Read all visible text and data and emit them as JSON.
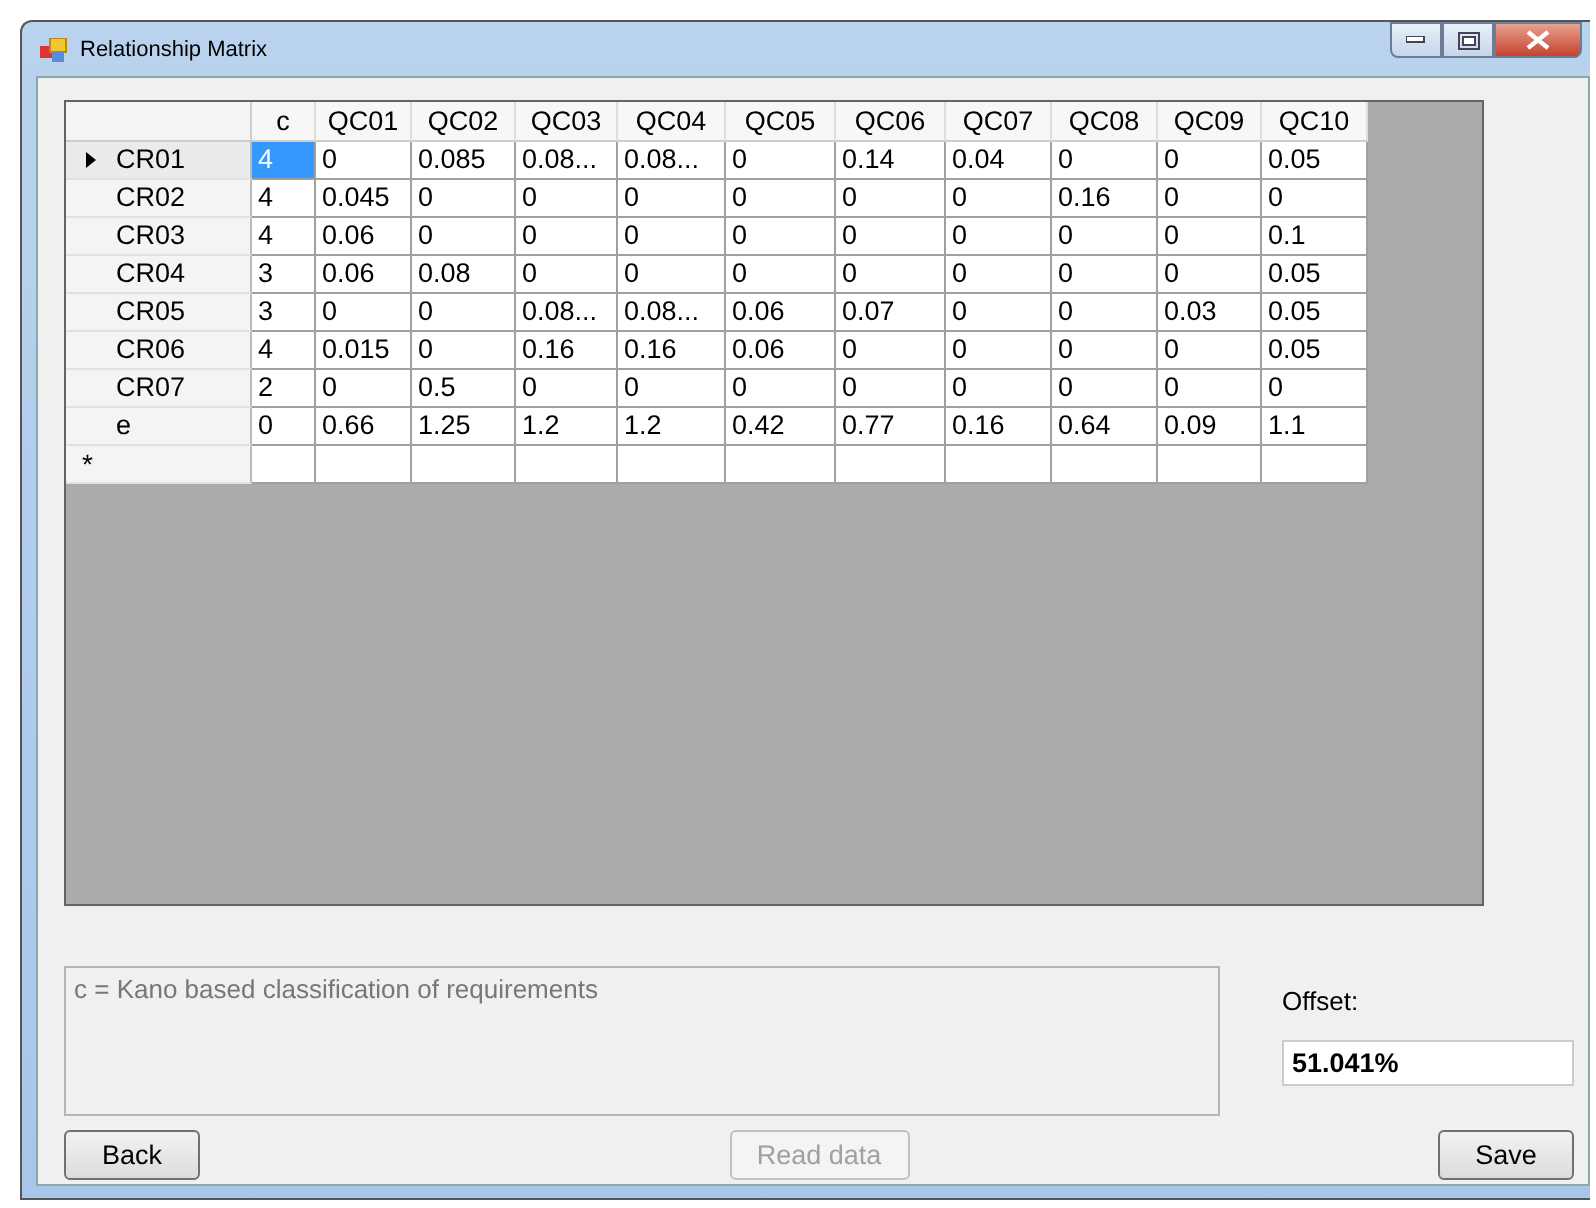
{
  "window": {
    "title": "Relationship Matrix"
  },
  "grid": {
    "columns": [
      "c",
      "QC01",
      "QC02",
      "QC03",
      "QC04",
      "QC05",
      "QC06",
      "QC07",
      "QC08",
      "QC09",
      "QC10"
    ],
    "rows": [
      {
        "header": "CR01",
        "current": true,
        "cells": [
          {
            "text": "4",
            "selected": true
          },
          {
            "text": "0",
            "selected": false
          },
          {
            "text": "0.085",
            "selected": false
          },
          {
            "text": "0.08...",
            "selected": false
          },
          {
            "text": "0.08...",
            "selected": false
          },
          {
            "text": "0",
            "selected": false
          },
          {
            "text": "0.14",
            "selected": false
          },
          {
            "text": "0.04",
            "selected": false
          },
          {
            "text": "0",
            "selected": false
          },
          {
            "text": "0",
            "selected": false
          },
          {
            "text": "0.05",
            "selected": false
          }
        ]
      },
      {
        "header": "CR02",
        "current": false,
        "cells": [
          {
            "text": "4",
            "selected": false
          },
          {
            "text": "0.045",
            "selected": false
          },
          {
            "text": "0",
            "selected": false
          },
          {
            "text": "0",
            "selected": false
          },
          {
            "text": "0",
            "selected": false
          },
          {
            "text": "0",
            "selected": false
          },
          {
            "text": "0",
            "selected": false
          },
          {
            "text": "0",
            "selected": false
          },
          {
            "text": "0.16",
            "selected": false
          },
          {
            "text": "0",
            "selected": false
          },
          {
            "text": "0",
            "selected": false
          }
        ]
      },
      {
        "header": "CR03",
        "current": false,
        "cells": [
          {
            "text": "4",
            "selected": false
          },
          {
            "text": "0.06",
            "selected": false
          },
          {
            "text": "0",
            "selected": false
          },
          {
            "text": "0",
            "selected": false
          },
          {
            "text": "0",
            "selected": false
          },
          {
            "text": "0",
            "selected": false
          },
          {
            "text": "0",
            "selected": false
          },
          {
            "text": "0",
            "selected": false
          },
          {
            "text": "0",
            "selected": false
          },
          {
            "text": "0",
            "selected": false
          },
          {
            "text": "0.1",
            "selected": false
          }
        ]
      },
      {
        "header": "CR04",
        "current": false,
        "cells": [
          {
            "text": "3",
            "selected": false
          },
          {
            "text": "0.06",
            "selected": false
          },
          {
            "text": "0.08",
            "selected": false
          },
          {
            "text": "0",
            "selected": false
          },
          {
            "text": "0",
            "selected": false
          },
          {
            "text": "0",
            "selected": false
          },
          {
            "text": "0",
            "selected": false
          },
          {
            "text": "0",
            "selected": false
          },
          {
            "text": "0",
            "selected": false
          },
          {
            "text": "0",
            "selected": false
          },
          {
            "text": "0.05",
            "selected": false
          }
        ]
      },
      {
        "header": "CR05",
        "current": false,
        "cells": [
          {
            "text": "3",
            "selected": false
          },
          {
            "text": "0",
            "selected": false
          },
          {
            "text": "0",
            "selected": false
          },
          {
            "text": "0.08...",
            "selected": false
          },
          {
            "text": "0.08...",
            "selected": false
          },
          {
            "text": "0.06",
            "selected": false
          },
          {
            "text": "0.07",
            "selected": false
          },
          {
            "text": "0",
            "selected": false
          },
          {
            "text": "0",
            "selected": false
          },
          {
            "text": "0.03",
            "selected": false
          },
          {
            "text": "0.05",
            "selected": false
          }
        ]
      },
      {
        "header": "CR06",
        "current": false,
        "cells": [
          {
            "text": "4",
            "selected": false
          },
          {
            "text": "0.015",
            "selected": false
          },
          {
            "text": "0",
            "selected": false
          },
          {
            "text": "0.16",
            "selected": false
          },
          {
            "text": "0.16",
            "selected": false
          },
          {
            "text": "0.06",
            "selected": false
          },
          {
            "text": "0",
            "selected": false
          },
          {
            "text": "0",
            "selected": false
          },
          {
            "text": "0",
            "selected": false
          },
          {
            "text": "0",
            "selected": false
          },
          {
            "text": "0.05",
            "selected": false
          }
        ]
      },
      {
        "header": "CR07",
        "current": false,
        "cells": [
          {
            "text": "2",
            "selected": false
          },
          {
            "text": "0",
            "selected": false
          },
          {
            "text": "0.5",
            "selected": false
          },
          {
            "text": "0",
            "selected": false
          },
          {
            "text": "0",
            "selected": false
          },
          {
            "text": "0",
            "selected": false
          },
          {
            "text": "0",
            "selected": false
          },
          {
            "text": "0",
            "selected": false
          },
          {
            "text": "0",
            "selected": false
          },
          {
            "text": "0",
            "selected": false
          },
          {
            "text": "0",
            "selected": false
          }
        ]
      },
      {
        "header": "e",
        "current": false,
        "cells": [
          {
            "text": "0",
            "selected": false
          },
          {
            "text": "0.66",
            "selected": false
          },
          {
            "text": "1.25",
            "selected": false
          },
          {
            "text": "1.2",
            "selected": false
          },
          {
            "text": "1.2",
            "selected": false
          },
          {
            "text": "0.42",
            "selected": false
          },
          {
            "text": "0.77",
            "selected": false
          },
          {
            "text": "0.16",
            "selected": false
          },
          {
            "text": "0.64",
            "selected": false
          },
          {
            "text": "0.09",
            "selected": false
          },
          {
            "text": "1.1",
            "selected": false
          }
        ]
      }
    ],
    "new_row": {
      "marker": "*"
    }
  },
  "note": {
    "value": "c = Kano based classification of requirements"
  },
  "offset": {
    "label": "Offset:",
    "value": "51.041%"
  },
  "buttons": [
    {
      "label": "Back",
      "disabled": false
    },
    {
      "label": "Read data",
      "disabled": true
    },
    {
      "label": "Save",
      "disabled": false
    }
  ]
}
